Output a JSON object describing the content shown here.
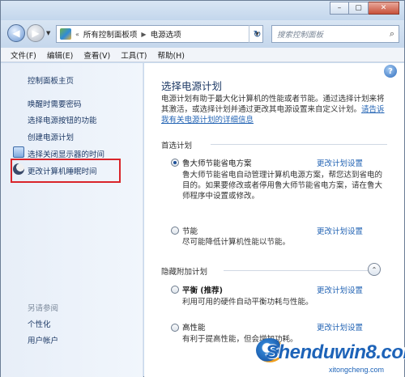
{
  "window": {
    "controls": {
      "minimize": "–",
      "maximize": "▢",
      "close": "✕"
    }
  },
  "address": {
    "breadcrumb": [
      "所有控制面板项",
      "电源选项"
    ],
    "separator": "▶",
    "search_placeholder": "搜索控制面板"
  },
  "menu": {
    "items": [
      "文件(F)",
      "编辑(E)",
      "查看(V)",
      "工具(T)",
      "帮助(H)"
    ]
  },
  "sidebar": {
    "home": "控制面板主页",
    "links": [
      "唤醒时需要密码",
      "选择电源按钮的功能",
      "创建电源计划",
      "选择关闭显示器的时间",
      "更改计算机睡眠时间"
    ],
    "see_also": "另请参阅",
    "bottom_links": [
      "个性化",
      "用户帐户"
    ]
  },
  "main": {
    "title": "选择电源计划",
    "description": "电源计划有助于最大化计算机的性能或者节能。通过选择计划来将其激活，或选择计划并通过更改其电源设置来自定义计划。",
    "description_link": "请告诉我有关电源计划的详细信息",
    "preferred_label": "首选计划",
    "hidden_label": "隐藏附加计划",
    "change_link": "更改计划设置",
    "plans": [
      {
        "name": "鲁大师节能省电方案",
        "selected": true,
        "bold": false,
        "desc": "鲁大师节能省电自动管理计算机电源方案，帮您达到省电的目的。如果要修改或者停用鲁大师节能省电方案，请在鲁大师程序中设置或修改。"
      },
      {
        "name": "节能",
        "selected": false,
        "bold": false,
        "desc": "尽可能降低计算机性能以节能。"
      },
      {
        "name": "平衡 (推荐)",
        "selected": false,
        "bold": true,
        "desc": "利用可用的硬件自动平衡功耗与性能。"
      },
      {
        "name": "高性能",
        "selected": false,
        "bold": false,
        "desc": "有利于提高性能，但会增加功耗。"
      }
    ]
  },
  "watermark": {
    "main": "Shenduwin8.com",
    "sub": "xitongcheng.com"
  },
  "colors": {
    "link": "#2364b4",
    "highlight": "#d9242a",
    "sidebar_link": "#1e3a66"
  }
}
